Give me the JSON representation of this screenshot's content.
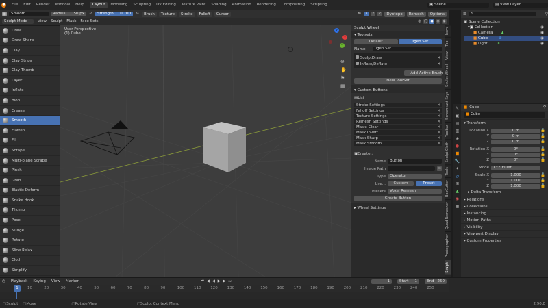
{
  "topbar": {
    "menus": [
      "File",
      "Edit",
      "Render",
      "Window",
      "Help"
    ],
    "workspaces": [
      "Layout",
      "Modeling",
      "Sculpting",
      "UV Editing",
      "Texture Paint",
      "Shading",
      "Animation",
      "Rendering",
      "Compositing",
      "Scripting"
    ],
    "active_workspace": "Layout",
    "scene": "Scene",
    "view_layer": "View Layer"
  },
  "tool_header": {
    "brush_name": "Smooth",
    "radius_label": "Radius",
    "radius_value": "50 px",
    "strength_label": "Strength",
    "strength_value": "0.700",
    "dropdowns": [
      "Brush",
      "Texture",
      "Stroke",
      "Falloff",
      "Cursor"
    ],
    "axes": [
      "X",
      "Y",
      "Z"
    ],
    "right_menus": [
      "Dyntopo",
      "Remesh",
      "Options"
    ]
  },
  "view_header": {
    "mode": "Sculpt Mode",
    "menus": [
      "View",
      "Sculpt",
      "Mask",
      "Face Sets"
    ]
  },
  "viewport": {
    "perspective": "User Perspective",
    "object": "(1) Cube",
    "gizmo_x": "X",
    "gizmo_y": "Y",
    "gizmo_z": "Z"
  },
  "tools": [
    "Draw",
    "Draw Sharp",
    "Clay",
    "Clay Strips",
    "Clay Thumb",
    "Layer",
    "Inflate",
    "Blob",
    "Crease",
    "Smooth",
    "Flatten",
    "Fill",
    "Scrape",
    "Multi-plane Scrape",
    "Pinch",
    "Grab",
    "Elastic Deform",
    "Snake Hook",
    "Thumb",
    "Pose",
    "Nudge",
    "Rotate",
    "Slide Relax",
    "Cloth",
    "Simplify"
  ],
  "selected_tool": "Smooth",
  "sculpt_wheel": {
    "title": "Sculpt Wheel",
    "toolsets_header": "Toolsets",
    "tab_default": "Default",
    "tab_active": "iigen Set",
    "name_label": "Name:",
    "name_value": "iigen Set",
    "toolset_items": [
      "SculptDraw",
      "Inflate/Deflate"
    ],
    "add_brush": "Add Active Brush",
    "new_toolset": "New ToolSet",
    "custom_header": "Custom Buttons",
    "list_header": "List :",
    "list_items": [
      "Stroke Settings",
      "Falloff Settings",
      "Texture Settings",
      "Remesh Settings",
      "Mask: Clear",
      "Mask Invert",
      "Mask Sharp",
      "Mask Smooth"
    ],
    "create_header": "Create :",
    "create_name_label": "Name",
    "create_name_value": "Button",
    "image_path_label": "Image Path",
    "type_label": "Type",
    "type_value": "Operator",
    "use_label": "Use...",
    "use_custom": "Custom",
    "use_preset": "Preset",
    "presets_label": "Presets",
    "presets_value": "Voxel Remesh",
    "create_button": "Create Button",
    "wheel_settings": "Wheel Settings"
  },
  "side_tabs": [
    "Item",
    "Tool",
    "View",
    "Sculpt Wheel",
    "Screencast Keys",
    "Toolbar",
    "Sculpt Cloth",
    "Tools",
    "BoxCutter",
    "Quad Remesher",
    "Photographer",
    "Sculpt"
  ],
  "active_side_tab": "Sculpt",
  "outliner": {
    "root": "Scene Collection",
    "collection": "Collection",
    "items": [
      "Camera",
      "Cube",
      "Light"
    ],
    "selected": "Cube"
  },
  "properties": {
    "object_name": "Cube",
    "object_field": "Cube",
    "transform_header": "Transform",
    "location_label": "Location X",
    "location": [
      "0 m",
      "0 m",
      "0 m"
    ],
    "rotation_label": "Rotation X",
    "rotation": [
      "0°",
      "0°",
      "0°"
    ],
    "mode_label": "Mode",
    "mode_value": "XYZ Euler",
    "scale_label": "Scale X",
    "scale": [
      "1.000",
      "1.000",
      "1.000"
    ],
    "axis_y": "Y",
    "axis_z": "Z",
    "delta": "Delta Transform",
    "sections": [
      "Relations",
      "Collections",
      "Instancing",
      "Motion Paths",
      "Visibility",
      "Viewport Display",
      "Custom Properties"
    ]
  },
  "timeline": {
    "menus": [
      "Playback",
      "Keying",
      "View",
      "Marker"
    ],
    "current_frame": "1",
    "start_label": "Start",
    "start": "1",
    "end_label": "End",
    "end": "250",
    "ticks": [
      "10",
      "20",
      "30",
      "40",
      "50",
      "60",
      "70",
      "80",
      "90",
      "100",
      "110",
      "120",
      "130",
      "140",
      "150",
      "160",
      "170",
      "180",
      "190",
      "200",
      "210",
      "220",
      "230",
      "240",
      "250"
    ],
    "playhead": "1"
  },
  "statusbar": {
    "items": [
      "Sculpt",
      "Move",
      "Rotate View",
      "Sculpt Context Menu"
    ],
    "version": "2.90.0"
  }
}
